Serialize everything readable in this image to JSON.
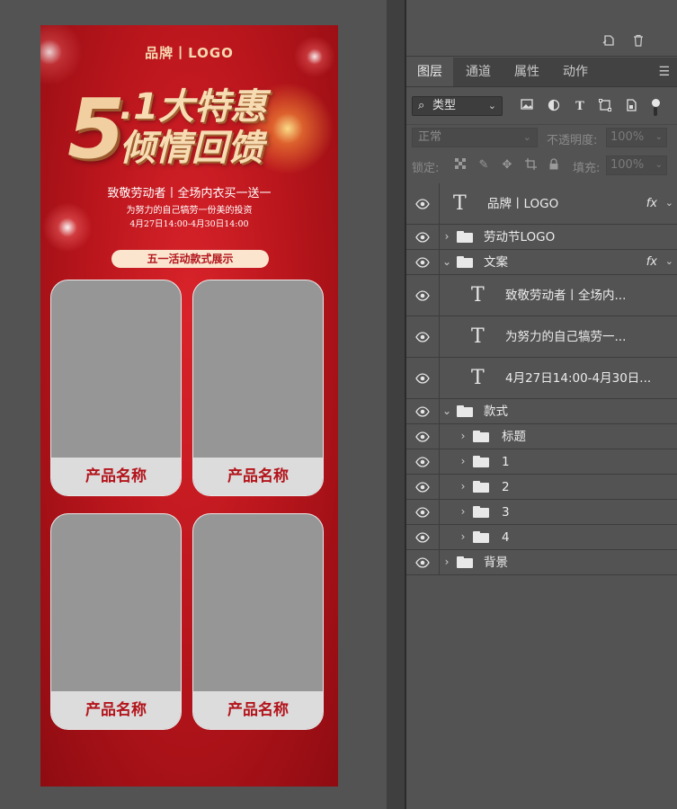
{
  "canvas": {
    "brand": "品牌丨LOGO",
    "headline_number": "5",
    "headline_line1": ".1大特惠",
    "headline_line2": "倾情回馈",
    "copy_line1": "致敬劳动者丨全场内衣买一送一",
    "copy_line2": "为努力的自己犒劳一份美的投资",
    "copy_line3": "4月27日14:00-4月30日14:00",
    "section_title": "五一活动款式展示",
    "cards": [
      {
        "label": "产品名称"
      },
      {
        "label": "产品名称"
      },
      {
        "label": "产品名称"
      },
      {
        "label": "产品名称"
      }
    ],
    "colors": {
      "background": "#c4161c",
      "accent": "#f6d9b0",
      "card_label": "#b3141b"
    }
  },
  "panel": {
    "tabs": [
      "图层",
      "通道",
      "属性",
      "动作"
    ],
    "filter": {
      "label": "类型",
      "icons": [
        "pixel-filter-icon",
        "adjustment-filter-icon",
        "type-filter-icon",
        "shape-filter-icon",
        "smart-object-filter-icon"
      ]
    },
    "blend_mode": "正常",
    "opacity_label": "不透明度:",
    "opacity_value": "100%",
    "lock_label": "锁定:",
    "fill_label": "填充:",
    "fill_value": "100%",
    "layers": [
      {
        "name": "品牌丨LOGO",
        "kind": "text",
        "fx": "fx"
      },
      {
        "name": "劳动节LOGO",
        "kind": "group",
        "expanded": false
      },
      {
        "name": "文案",
        "kind": "group",
        "expanded": true,
        "fx": "fx"
      },
      {
        "name": "致敬劳动者丨全场内...",
        "kind": "text"
      },
      {
        "name": "为努力的自己犒劳一...",
        "kind": "text"
      },
      {
        "name": "4月27日14:00-4月30日...",
        "kind": "text"
      },
      {
        "name": "款式",
        "kind": "group",
        "expanded": true
      },
      {
        "name": "标题",
        "kind": "group",
        "expanded": false
      },
      {
        "name": "1",
        "kind": "group",
        "expanded": false
      },
      {
        "name": "2",
        "kind": "group",
        "expanded": false
      },
      {
        "name": "3",
        "kind": "group",
        "expanded": false
      },
      {
        "name": "4",
        "kind": "group",
        "expanded": false
      },
      {
        "name": "背景",
        "kind": "group",
        "expanded": false
      }
    ]
  }
}
